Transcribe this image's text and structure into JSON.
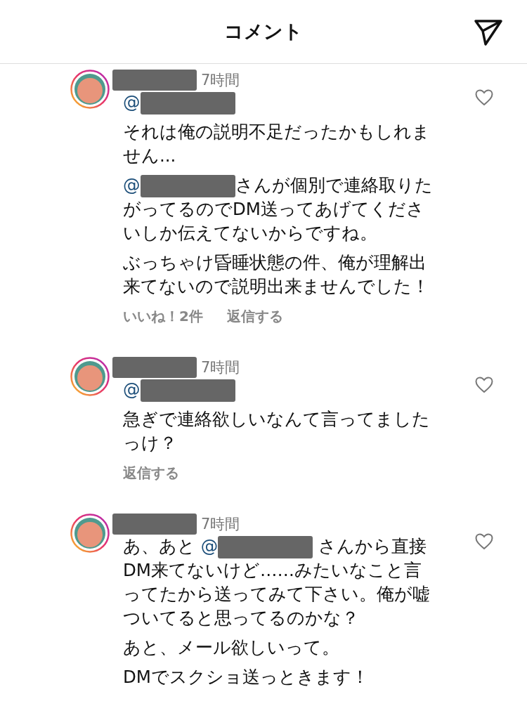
{
  "header": {
    "title": "コメント"
  },
  "comments": [
    {
      "time": "7時間",
      "liked": false,
      "paragraphs": [
        [
          {
            "kind": "mention",
            "text": "@"
          },
          {
            "kind": "redacted"
          }
        ],
        [
          {
            "kind": "text",
            "text": "それは俺の説明不足だったかもしれません..."
          }
        ],
        [
          {
            "kind": "mention",
            "text": "@"
          },
          {
            "kind": "redacted"
          },
          {
            "kind": "text",
            "text": "さんが個別で連絡取りたがってるのでDM送ってあげてくださいしか伝えてないからですね。"
          }
        ],
        [
          {
            "kind": "text",
            "text": "ぶっちゃけ昏睡状態の件、俺が理解出来てないので説明出来ませんでした！"
          }
        ]
      ],
      "actions": [
        "いいね！2件",
        "返信する"
      ]
    },
    {
      "time": "7時間",
      "liked": false,
      "paragraphs": [
        [
          {
            "kind": "mention",
            "text": "@"
          },
          {
            "kind": "redacted"
          }
        ],
        [
          {
            "kind": "text",
            "text": "急ぎで連絡欲しいなんて言ってましたっけ？"
          }
        ]
      ],
      "actions": [
        "返信する"
      ]
    },
    {
      "time": "7時間",
      "liked": false,
      "paragraphs": [
        [
          {
            "kind": "text",
            "text": "あ、あと "
          },
          {
            "kind": "mention",
            "text": "@"
          },
          {
            "kind": "redacted"
          },
          {
            "kind": "text",
            "text": " さんから直接DM来てないけど……みたいなこと言ってたから送ってみて下さい。俺が嘘ついてると思ってるのかな？"
          }
        ],
        [
          {
            "kind": "text",
            "text": "あと、メール欲しいって。"
          }
        ],
        [
          {
            "kind": "text",
            "text": "DMでスクショ送っときます！"
          }
        ]
      ]
    }
  ]
}
